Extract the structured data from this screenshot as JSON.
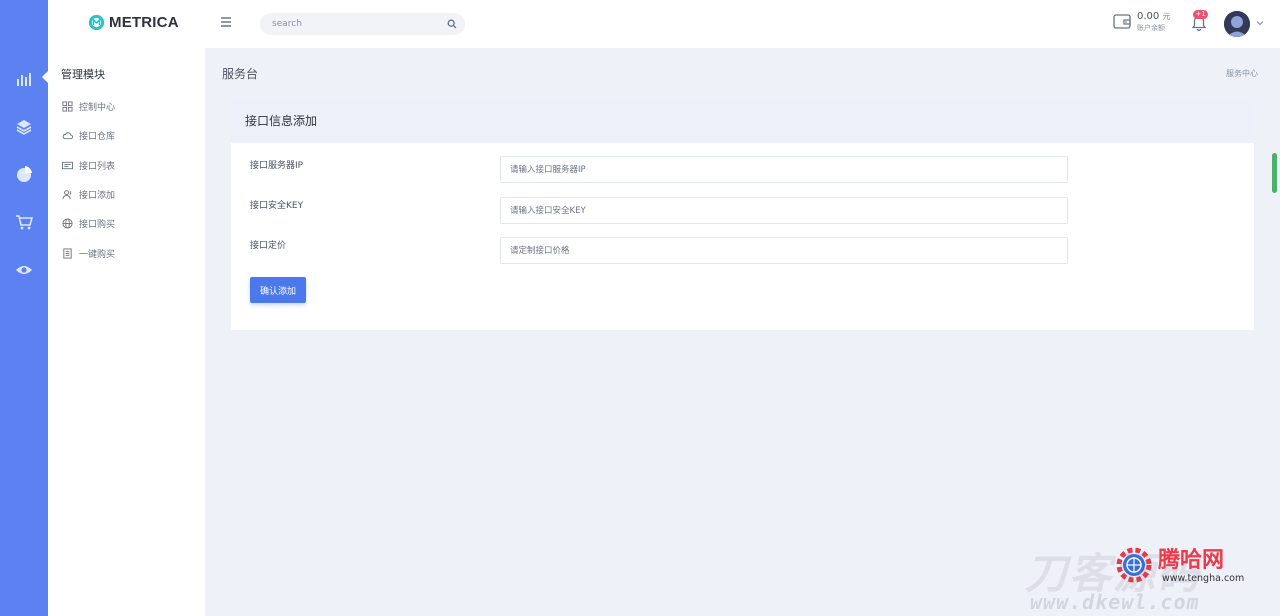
{
  "app": {
    "logo_text": "METRICA"
  },
  "rail": {
    "icons": [
      "bar-chart-icon",
      "layers-icon",
      "pie-chart-icon",
      "cart-icon",
      "eye-icon"
    ]
  },
  "sidebar": {
    "section_title": "管理模块",
    "items": [
      {
        "label": "控制中心",
        "icon": "grid-icon"
      },
      {
        "label": "接口仓库",
        "icon": "cloud-icon"
      },
      {
        "label": "接口列表",
        "icon": "list-card-icon"
      },
      {
        "label": "接口添加",
        "icon": "users-icon"
      },
      {
        "label": "接口购买",
        "icon": "globe-icon"
      },
      {
        "label": "一键购买",
        "icon": "document-icon"
      }
    ]
  },
  "topbar": {
    "search_placeholder": "search",
    "balance_amount": "0.00",
    "balance_unit": "元",
    "balance_label": "账户余额",
    "notification_count": "+1"
  },
  "page": {
    "title": "服务台",
    "breadcrumb": "服务中心"
  },
  "card": {
    "title": "接口信息添加",
    "fields": [
      {
        "label": "接口服务器IP",
        "placeholder": "请输入接口服务器IP",
        "value": ""
      },
      {
        "label": "接口安全KEY",
        "placeholder": "请输入接口安全KEY",
        "value": ""
      },
      {
        "label": "接口定价",
        "placeholder": "请定制接口价格",
        "value": ""
      }
    ],
    "submit_label": "确认添加"
  },
  "watermark": {
    "brand": "腾哈网",
    "url": "www.tengha.com",
    "url2": "www.dkewl.com",
    "text": "刀客源码"
  },
  "colors": {
    "rail": "#5b82f0",
    "accent": "#4c78ee",
    "badge": "#f0506e",
    "background": "#eef1f8"
  }
}
